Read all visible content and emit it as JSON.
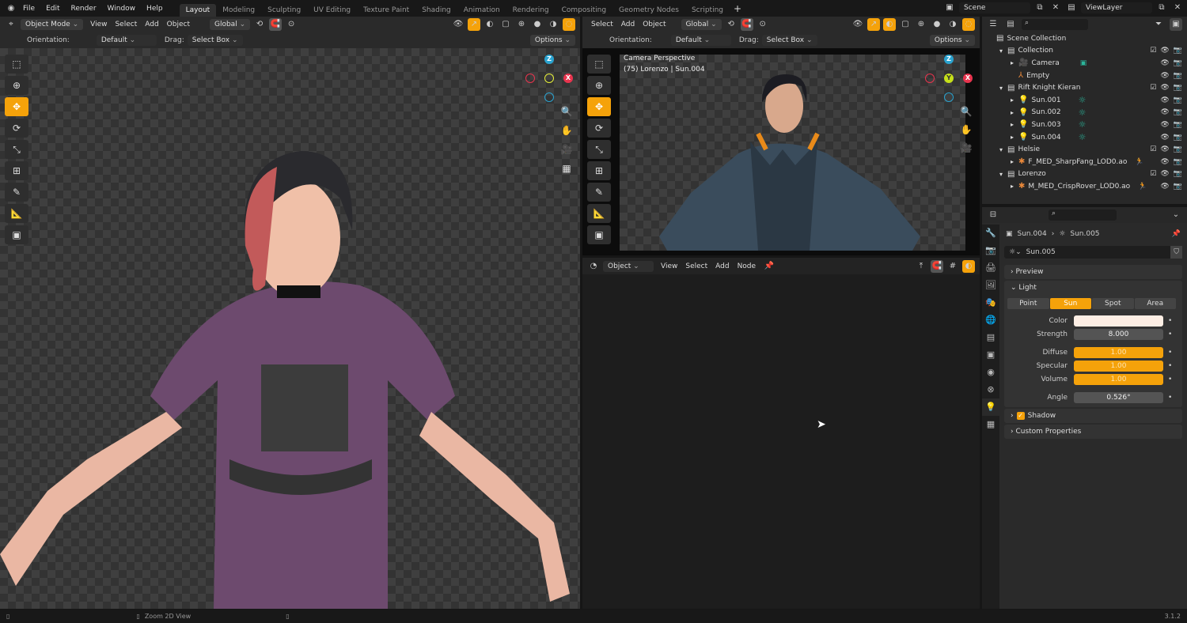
{
  "topbar": {
    "menus": [
      "File",
      "Edit",
      "Render",
      "Window",
      "Help"
    ],
    "workspaces": [
      "Layout",
      "Modeling",
      "Sculpting",
      "UV Editing",
      "Texture Paint",
      "Shading",
      "Animation",
      "Rendering",
      "Compositing",
      "Geometry Nodes",
      "Scripting"
    ],
    "active_workspace": "Layout",
    "add_tab": "+",
    "scene": "Scene",
    "view_layer": "ViewLayer"
  },
  "viewport_left": {
    "mode": "Object Mode",
    "menus": [
      "View",
      "Select",
      "Add",
      "Object"
    ],
    "transform_orientation": "Global",
    "orientation_label": "Orientation:",
    "orientation": "Default",
    "drag_label": "Drag:",
    "drag": "Select Box",
    "options": "Options"
  },
  "viewport_right": {
    "menus": [
      "Select",
      "Add",
      "Object"
    ],
    "transform_orientation": "Global",
    "orientation_label": "Orientation:",
    "orientation": "Default",
    "drag_label": "Drag:",
    "drag": "Select Box",
    "options": "Options",
    "overlay_title": "Camera Perspective",
    "overlay_sub": "(75) Lorenzo | Sun.004"
  },
  "gizmo": {
    "z": "Z",
    "x": "X",
    "y": "Y"
  },
  "node_editor": {
    "type": "Object",
    "menus": [
      "View",
      "Select",
      "Add",
      "Node"
    ]
  },
  "outliner": {
    "root": "Scene Collection",
    "rows": [
      {
        "label": "Collection",
        "depth": 0,
        "type": "collection",
        "check": true
      },
      {
        "label": "Camera",
        "depth": 1,
        "type": "camera"
      },
      {
        "label": "Empty",
        "depth": 1,
        "type": "empty"
      },
      {
        "label": "Rift Knight Kieran",
        "depth": 0,
        "type": "collection",
        "check": true
      },
      {
        "label": "Sun.001",
        "depth": 1,
        "type": "light"
      },
      {
        "label": "Sun.002",
        "depth": 1,
        "type": "light"
      },
      {
        "label": "Sun.003",
        "depth": 1,
        "type": "light"
      },
      {
        "label": "Sun.004",
        "depth": 1,
        "type": "light"
      },
      {
        "label": "Helsie",
        "depth": 0,
        "type": "collection",
        "check": true
      },
      {
        "label": "F_MED_SharpFang_LOD0.ao",
        "depth": 1,
        "type": "armature"
      },
      {
        "label": "Lorenzo",
        "depth": 0,
        "type": "collection",
        "check": true
      },
      {
        "label": "M_MED_CrispRover_LOD0.ao",
        "depth": 1,
        "type": "armature"
      }
    ]
  },
  "properties": {
    "breadcrumb_object": "Sun.004",
    "breadcrumb_data": "Sun.005",
    "datablock": "Sun.005",
    "preview": "Preview",
    "light_panel": "Light",
    "light_types": [
      "Point",
      "Sun",
      "Spot",
      "Area"
    ],
    "active_type": "Sun",
    "fields": [
      {
        "label": "Color",
        "value": "",
        "color": "#fdeee4"
      },
      {
        "label": "Strength",
        "value": "8.000"
      },
      {
        "label": "Diffuse",
        "value": "1.00",
        "fill": 1.0
      },
      {
        "label": "Specular",
        "value": "1.00",
        "fill": 1.0
      },
      {
        "label": "Volume",
        "value": "1.00",
        "fill": 1.0
      },
      {
        "label": "Angle",
        "value": "0.526°"
      }
    ],
    "shadow": "Shadow",
    "shadow_enabled": true,
    "custom_properties": "Custom Properties"
  },
  "statusbar": {
    "hint": "Zoom 2D View",
    "version": "3.1.2"
  },
  "colors": {
    "accent": "#f5a20a",
    "gizmo_x": "#e8344e",
    "gizmo_y": "#8fd01a",
    "gizmo_z": "#2aa3d0"
  }
}
